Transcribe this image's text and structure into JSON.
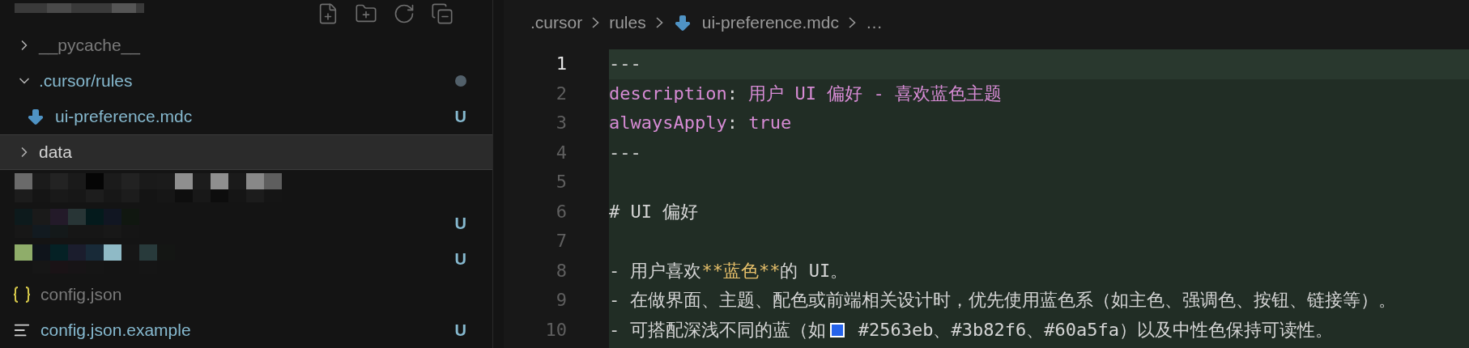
{
  "explorer": {
    "items": [
      {
        "kind": "folder",
        "name": "__pycache__",
        "expanded": false,
        "selected": false,
        "dimmed": true
      },
      {
        "kind": "folder",
        "name": ".cursor/rules",
        "expanded": true,
        "selected": false,
        "dimmed": false,
        "untracked": true,
        "dot": true,
        "children": [
          {
            "kind": "mdc",
            "name": "ui-preference.mdc",
            "selected": false,
            "dimmed": false,
            "untracked": true,
            "badge": "U"
          }
        ]
      },
      {
        "kind": "folder",
        "name": "data",
        "expanded": false,
        "selected": true,
        "dimmed": false,
        "untracked": false
      },
      {
        "kind": "redacted",
        "selected": false
      },
      {
        "kind": "redacted",
        "selected": false,
        "badge": "U"
      },
      {
        "kind": "redacted",
        "selected": false,
        "badge": "U"
      },
      {
        "kind": "json",
        "name": "config.json",
        "selected": false,
        "dimmed": true
      },
      {
        "kind": "text",
        "name": "config.json.example",
        "selected": false,
        "dimmed": false,
        "untracked": true,
        "badge": "U"
      }
    ]
  },
  "breadcrumb": [
    {
      "kind": "text",
      "label": ".cursor"
    },
    {
      "kind": "text",
      "label": "rules"
    },
    {
      "kind": "file",
      "label": "ui-preference.mdc"
    },
    {
      "kind": "text",
      "label": "…"
    }
  ],
  "editor": {
    "lines": [
      {
        "number": "1",
        "selected": true,
        "tokens": [
          {
            "kind": "punct",
            "text": "---"
          }
        ]
      },
      {
        "number": "2",
        "selected": false,
        "tokens": [
          {
            "kind": "key",
            "text": "description"
          },
          {
            "kind": "punct",
            "text": ": "
          },
          {
            "kind": "key",
            "text": "用户 UI 偏好 - 喜欢蓝色主题"
          }
        ]
      },
      {
        "number": "3",
        "selected": false,
        "tokens": [
          {
            "kind": "key",
            "text": "alwaysApply"
          },
          {
            "kind": "punct",
            "text": ": "
          },
          {
            "kind": "key",
            "text": "true"
          }
        ]
      },
      {
        "number": "4",
        "selected": false,
        "tokens": [
          {
            "kind": "punct",
            "text": "---"
          }
        ]
      },
      {
        "number": "5",
        "selected": false
      },
      {
        "number": "6",
        "selected": false,
        "tokens": [
          {
            "kind": "text",
            "text": "# UI 偏好"
          }
        ]
      },
      {
        "number": "7",
        "selected": false
      },
      {
        "number": "8",
        "selected": false,
        "tokens": [
          {
            "kind": "text",
            "text": "- 用户喜欢"
          },
          {
            "kind": "bold",
            "text": "**蓝色**"
          },
          {
            "kind": "text",
            "text": "的 UI。"
          }
        ]
      },
      {
        "number": "9",
        "selected": false,
        "tokens": [
          {
            "kind": "text",
            "text": "- 在做界面、主题、配色或前端相关设计时，优先使用蓝色系（如主色、强调色、按钮、链接等）。"
          }
        ]
      },
      {
        "number": "10",
        "selected": false,
        "tokens": [
          {
            "kind": "text",
            "text": "- 可搭配深浅不同的蓝（如"
          },
          {
            "kind": "swatch",
            "color": "#2563eb"
          },
          {
            "kind": "text",
            "text": " #2563eb、#3b82f6、#60a5fa）以及中性色保持可读性。"
          }
        ]
      }
    ]
  }
}
